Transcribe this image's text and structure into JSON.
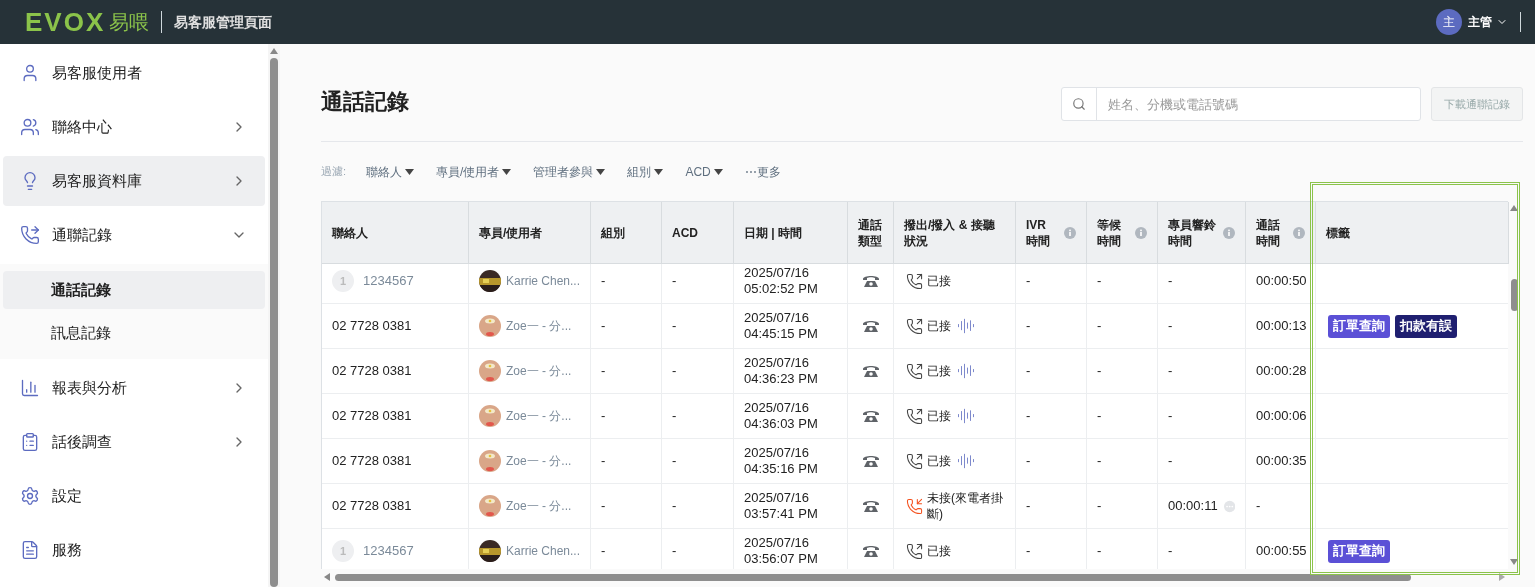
{
  "header": {
    "logo_text": "EVOX",
    "logo_cjk": "易喂",
    "title": "易客服管理頁面",
    "user": {
      "avatar": "主",
      "name": "主管"
    }
  },
  "sidebar": {
    "items": [
      {
        "label": "易客服使用者",
        "chevron": false,
        "hovered": false
      },
      {
        "label": "聯絡中心",
        "chevron": true,
        "expanded": false,
        "hovered": false
      },
      {
        "label": "易客服資料庫",
        "chevron": true,
        "expanded": false,
        "hovered": true
      },
      {
        "label": "通聯記錄",
        "chevron": true,
        "expanded": true,
        "hovered": false,
        "children": [
          {
            "label": "通話記錄",
            "selected": true
          },
          {
            "label": "訊息記錄",
            "selected": false
          }
        ]
      },
      {
        "label": "報表與分析",
        "chevron": true,
        "expanded": false,
        "hovered": false
      },
      {
        "label": "話後調查",
        "chevron": true,
        "expanded": false,
        "hovered": false
      },
      {
        "label": "設定",
        "chevron": false,
        "hovered": false
      },
      {
        "label": "服務",
        "chevron": false,
        "hovered": false
      }
    ]
  },
  "page": {
    "title": "通話記錄",
    "search": {
      "placeholder": "姓名、分機或電話號碼"
    },
    "download_button": {
      "label": "下載通聯記錄",
      "disabled": true
    }
  },
  "filters": {
    "label": "過濾:",
    "items": [
      "聯絡人",
      "專員/使用者",
      "管理者參與",
      "組別",
      "ACD"
    ],
    "more": "⋯更多"
  },
  "table": {
    "columns": [
      {
        "label": "聯絡人",
        "info": false
      },
      {
        "label": "專員/使用者",
        "info": false
      },
      {
        "label": "組別",
        "info": false
      },
      {
        "label": "ACD",
        "info": false
      },
      {
        "label": "日期 | 時間",
        "info": false
      },
      {
        "label": "通話類型",
        "info": false
      },
      {
        "label": "撥出/撥入 & 接聽狀況",
        "info": false
      },
      {
        "label": "IVR 時間",
        "info": true
      },
      {
        "label": "等候時間",
        "info": true
      },
      {
        "label": "專員響鈴時間",
        "info": true
      },
      {
        "label": "通話時間",
        "info": true
      },
      {
        "label": "標籤",
        "info": false
      }
    ],
    "rows": [
      {
        "contact": "1234567",
        "contact_badge": "1",
        "agent": {
          "name": "Karrie Chen..."
        },
        "group": "-",
        "acd": "-",
        "date": "2025/07/16",
        "time": "05:02:52 PM",
        "status": {
          "text": "已接",
          "kind": "answered",
          "recording": false
        },
        "ivr": "-",
        "wait": "-",
        "ring": "-",
        "ring_info": false,
        "duration": "00:00:50",
        "tags": []
      },
      {
        "contact": "02 7728 0381",
        "agent": {
          "name": "Zoe一 - 分...",
          "kind": "cartoon"
        },
        "group": "-",
        "acd": "-",
        "date": "2025/07/16",
        "time": "04:45:15 PM",
        "status": {
          "text": "已接",
          "kind": "answered",
          "recording": true
        },
        "ivr": "-",
        "wait": "-",
        "ring": "-",
        "ring_info": false,
        "duration": "00:00:13",
        "tags": [
          {
            "label": "訂單查詢",
            "color": "#5b50d6"
          },
          {
            "label": "扣款有誤",
            "color": "#1f1f70"
          }
        ]
      },
      {
        "contact": "02 7728 0381",
        "agent": {
          "name": "Zoe一 - 分...",
          "kind": "cartoon"
        },
        "group": "-",
        "acd": "-",
        "date": "2025/07/16",
        "time": "04:36:23 PM",
        "status": {
          "text": "已接",
          "kind": "answered",
          "recording": true
        },
        "ivr": "-",
        "wait": "-",
        "ring": "-",
        "ring_info": false,
        "duration": "00:00:28",
        "tags": []
      },
      {
        "contact": "02 7728 0381",
        "agent": {
          "name": "Zoe一 - 分...",
          "kind": "cartoon"
        },
        "group": "-",
        "acd": "-",
        "date": "2025/07/16",
        "time": "04:36:03 PM",
        "status": {
          "text": "已接",
          "kind": "answered",
          "recording": true
        },
        "ivr": "-",
        "wait": "-",
        "ring": "-",
        "ring_info": false,
        "duration": "00:00:06",
        "tags": []
      },
      {
        "contact": "02 7728 0381",
        "agent": {
          "name": "Zoe一 - 分...",
          "kind": "cartoon"
        },
        "group": "-",
        "acd": "-",
        "date": "2025/07/16",
        "time": "04:35:16 PM",
        "status": {
          "text": "已接",
          "kind": "answered",
          "recording": true
        },
        "ivr": "-",
        "wait": "-",
        "ring": "-",
        "ring_info": false,
        "duration": "00:00:35",
        "tags": []
      },
      {
        "contact": "02 7728 0381",
        "agent": {
          "name": "Zoe一 - 分...",
          "kind": "cartoon"
        },
        "group": "-",
        "acd": "-",
        "date": "2025/07/16",
        "time": "03:57:41 PM",
        "status": {
          "text": "未接(來電者掛斷)",
          "kind": "missed",
          "recording": false
        },
        "ivr": "-",
        "wait": "-",
        "ring": "00:00:11",
        "ring_info": true,
        "duration": "-",
        "tags": []
      },
      {
        "contact": "1234567",
        "contact_badge": "1",
        "agent": {
          "name": "Karrie Chen..."
        },
        "group": "-",
        "acd": "-",
        "date": "2025/07/16",
        "time": "03:56:07 PM",
        "status": {
          "text": "已接",
          "kind": "answered",
          "recording": false
        },
        "ivr": "-",
        "wait": "-",
        "ring": "-",
        "ring_info": false,
        "duration": "00:00:55",
        "tags": [
          {
            "label": "訂單查詢",
            "color": "#5b50d6"
          }
        ]
      }
    ]
  }
}
